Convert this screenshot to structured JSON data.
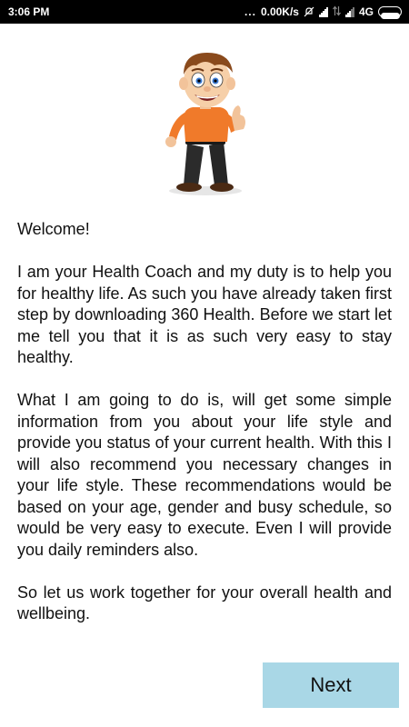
{
  "status_bar": {
    "time": "3:06 PM",
    "dots": "...",
    "network_speed": "0.00K/s",
    "network_type": "4G",
    "icons": [
      "muted-bell-icon",
      "signal-icon",
      "data-transfer-icon",
      "signal-icon",
      "battery-icon"
    ]
  },
  "mascot": {
    "icon": "thumbs-up-cartoon-coach"
  },
  "content": {
    "greeting": "Welcome!",
    "paragraph1": "I am your Health Coach and my duty is to help you for healthy life. As such you have already taken first step by downloading 360 Health. Before we start let me tell you that it is as such very easy to stay healthy.",
    "paragraph2": "What I am going to do is, will get some simple information from you about your life style and provide you status of your current health. With this I will also recommend you necessary changes in your life style. These recommendations would be based on your age, gender and busy schedule, so would be very easy to execute. Even I will provide you daily reminders also.",
    "paragraph3": "So let us work together for your overall health and wellbeing."
  },
  "actions": {
    "next_label": "Next"
  },
  "colors": {
    "status_bar_bg": "#000000",
    "next_button_bg": "#a9d7e6",
    "shirt": "#f07a2a",
    "hair": "#8a4a1c"
  }
}
